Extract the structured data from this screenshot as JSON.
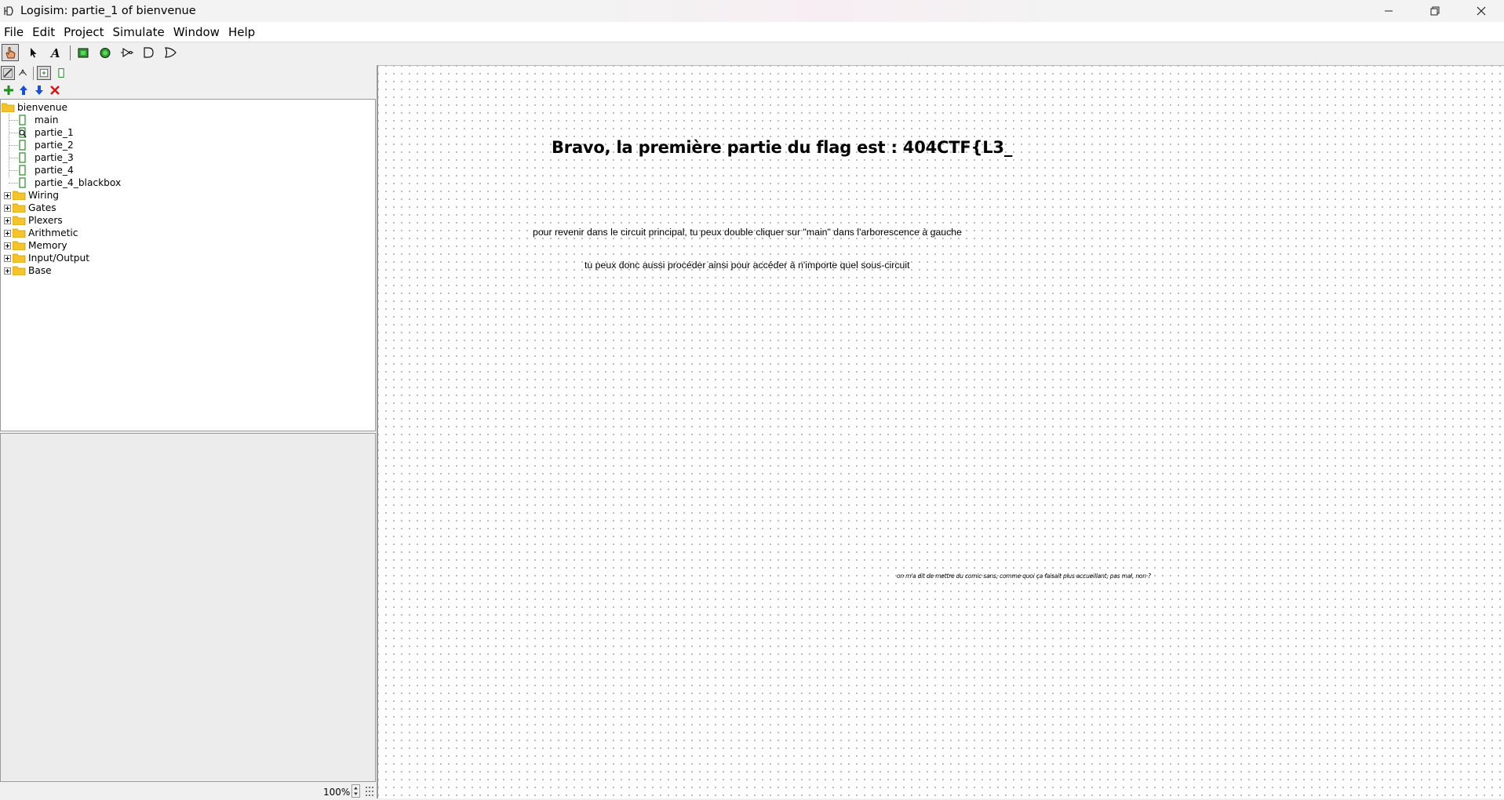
{
  "window": {
    "title": "Logisim: partie_1 of bienvenue",
    "controls": [
      "minimize",
      "restore",
      "close"
    ]
  },
  "menubar": {
    "items": [
      "File",
      "Edit",
      "Project",
      "Simulate",
      "Window",
      "Help"
    ]
  },
  "toolbar": {
    "tools": [
      "poke-tool",
      "select-tool",
      "text-tool",
      "input-pin",
      "output-pin",
      "not-gate",
      "and-gate",
      "or-gate"
    ],
    "selected_tool": "poke-tool",
    "view_tools": [
      "toolbox-view",
      "simulation-view",
      "layout-view",
      "appearance-view"
    ],
    "project_tools": [
      "add-circuit",
      "move-up",
      "move-down",
      "remove-circuit"
    ]
  },
  "explorer": {
    "project": "bienvenue",
    "circuits": [
      "main",
      "partie_1",
      "partie_2",
      "partie_3",
      "partie_4",
      "partie_4_blackbox"
    ],
    "active_circuit": "partie_1",
    "libraries": [
      "Wiring",
      "Gates",
      "Plexers",
      "Arithmetic",
      "Memory",
      "Input/Output",
      "Base"
    ]
  },
  "status": {
    "zoom": "100%"
  },
  "canvas": {
    "heading": "Bravo, la première partie du flag est : 404CTF{L3_",
    "line1": "pour revenir dans le circuit principal, tu peux double cliquer sur \"main\" dans l'arborescence à gauche",
    "line2": "tu peux donc aussi procéder ainsi pour accéder à n'importe quel sous-circuit",
    "tiny_note": "on m'a dit de mettre du comic sans, comme quoi ça faisait plus accueillant, pas mal, non ?"
  }
}
